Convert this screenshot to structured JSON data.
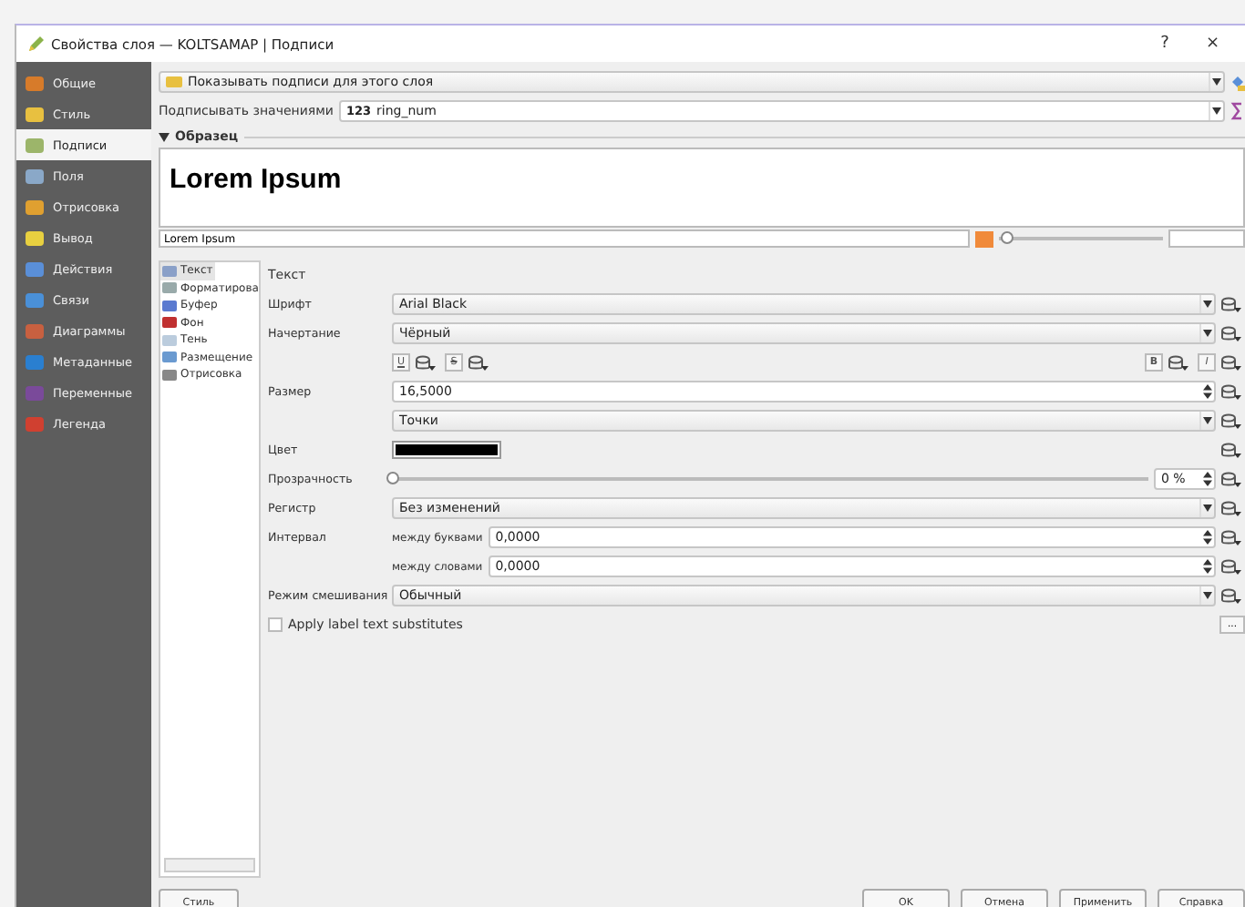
{
  "window": {
    "title": "Свойства слоя — KOLTSAMAP | Подписи",
    "help": "?",
    "close": "×"
  },
  "sidebar": {
    "items": [
      {
        "label": "Общие",
        "selected": false
      },
      {
        "label": "Стиль",
        "selected": false
      },
      {
        "label": "Подписи",
        "selected": true
      },
      {
        "label": "Поля",
        "selected": false
      },
      {
        "label": "Отрисовка",
        "selected": false
      },
      {
        "label": "Вывод",
        "selected": false
      },
      {
        "label": "Действия",
        "selected": false
      },
      {
        "label": "Связи",
        "selected": false
      },
      {
        "label": "Диаграммы",
        "selected": false
      },
      {
        "label": "Метаданные",
        "selected": false
      },
      {
        "label": "Переменные",
        "selected": false
      },
      {
        "label": "Легенда",
        "selected": false
      }
    ]
  },
  "labels_mode": {
    "value": "Показывать подписи для этого слоя"
  },
  "label_with": {
    "label": "Подписывать значениями",
    "type_badge": "123",
    "value": "ring_num"
  },
  "sample": {
    "header": "Образец",
    "expanded": true,
    "preview_text": "Lorem Ipsum",
    "sample_text": "Lorem Ipsum",
    "zoom": {
      "level": 0.04
    }
  },
  "tabs": [
    {
      "label": "Текст",
      "selected": true
    },
    {
      "label": "Форматирова",
      "selected": false
    },
    {
      "label": "Буфер",
      "selected": false
    },
    {
      "label": "Фон",
      "selected": false
    },
    {
      "label": "Тень",
      "selected": false
    },
    {
      "label": "Размещение",
      "selected": false
    },
    {
      "label": "Отрисовка",
      "selected": false
    }
  ],
  "text_panel": {
    "title": "Текст",
    "rows": [
      {
        "kind": "combo",
        "label": "Шрифт",
        "value": "Arial Black"
      },
      {
        "kind": "combo",
        "label": "Начертание",
        "value": "Чёрный"
      },
      {
        "kind": "styles",
        "left": [
          "U",
          "S"
        ],
        "right": [
          "B",
          "I"
        ]
      },
      {
        "kind": "spin",
        "label": "Размер",
        "value": "16,5000"
      },
      {
        "kind": "combo",
        "value": "Точки"
      },
      {
        "kind": "color",
        "label": "Цвет",
        "color": "#000000"
      },
      {
        "kind": "slider",
        "label": "Прозрачность",
        "level": 0,
        "reading": "0 %"
      },
      {
        "kind": "combo",
        "label": "Регистр",
        "value": "Без изменений"
      },
      {
        "kind": "spin",
        "label": "Интервал",
        "sublabel": "между буквами",
        "value": "0,0000"
      },
      {
        "kind": "spin",
        "sublabel": "между словами",
        "value": "0,0000"
      },
      {
        "kind": "combo",
        "label": "Режим смешивания",
        "value": "Обычный"
      },
      {
        "kind": "checkbox",
        "label": "Apply label text substitutes",
        "checked": false,
        "button": "..."
      }
    ]
  },
  "footer": {
    "style_menu": "Стиль",
    "buttons": [
      "OK",
      "Отмена",
      "Применить",
      "Справка"
    ]
  }
}
